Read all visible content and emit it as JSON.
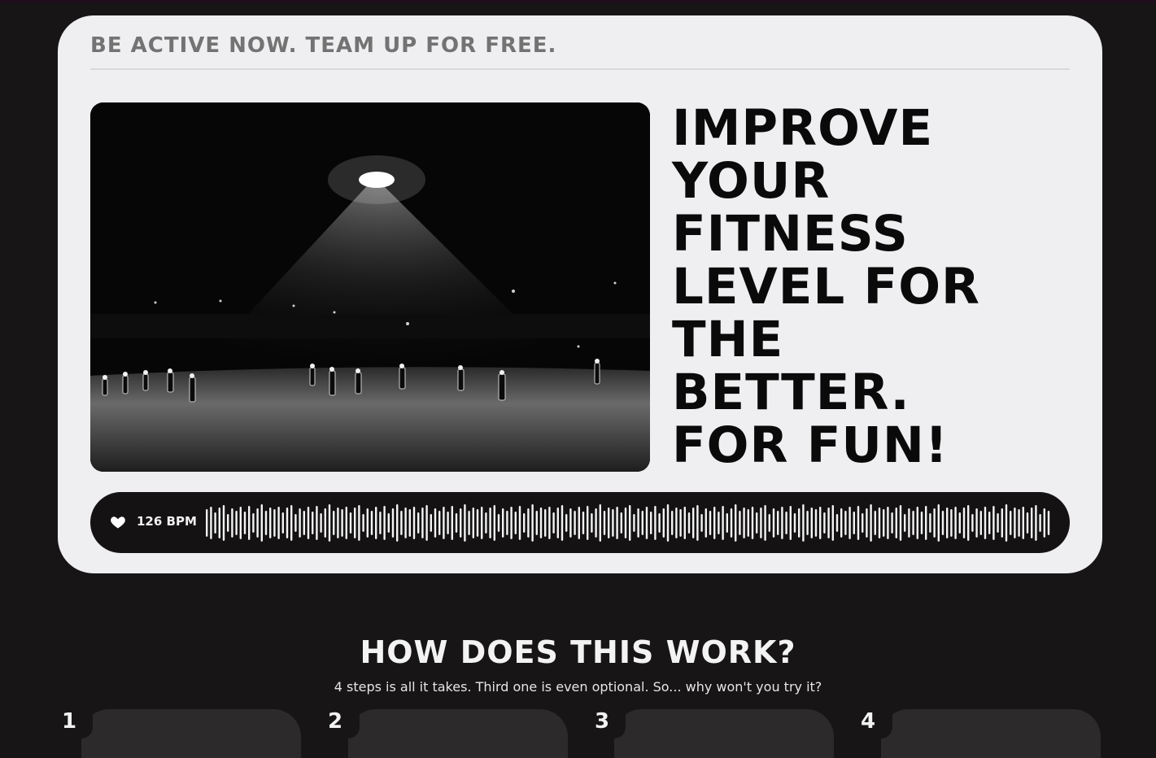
{
  "hero": {
    "tagline": "BE ACTIVE NOW. TEAM UP FOR FREE.",
    "headline_lines": [
      "IMPROVE",
      "YOUR",
      "FITNESS",
      "LEVEL FOR",
      "THE",
      "BETTER.",
      "FOR FUN!"
    ],
    "photo_icon": "night-football-photo"
  },
  "heartbeat": {
    "icon": "heart-icon",
    "label": "126 BPM"
  },
  "how_it_works": {
    "title": "HOW DOES THIS WORK?",
    "subtitle": "4 steps is all it takes. Third one is even optional. So... why won't you try it?",
    "steps": [
      {
        "number": "1"
      },
      {
        "number": "2"
      },
      {
        "number": "3"
      },
      {
        "number": "4"
      }
    ]
  },
  "colors": {
    "page_bg": "#171516",
    "card_bg": "#efeef0",
    "headline": "#0a0a0a",
    "tagline": "#737373",
    "bpm_bar": "#141213",
    "step_card": "#2c2a2b"
  }
}
